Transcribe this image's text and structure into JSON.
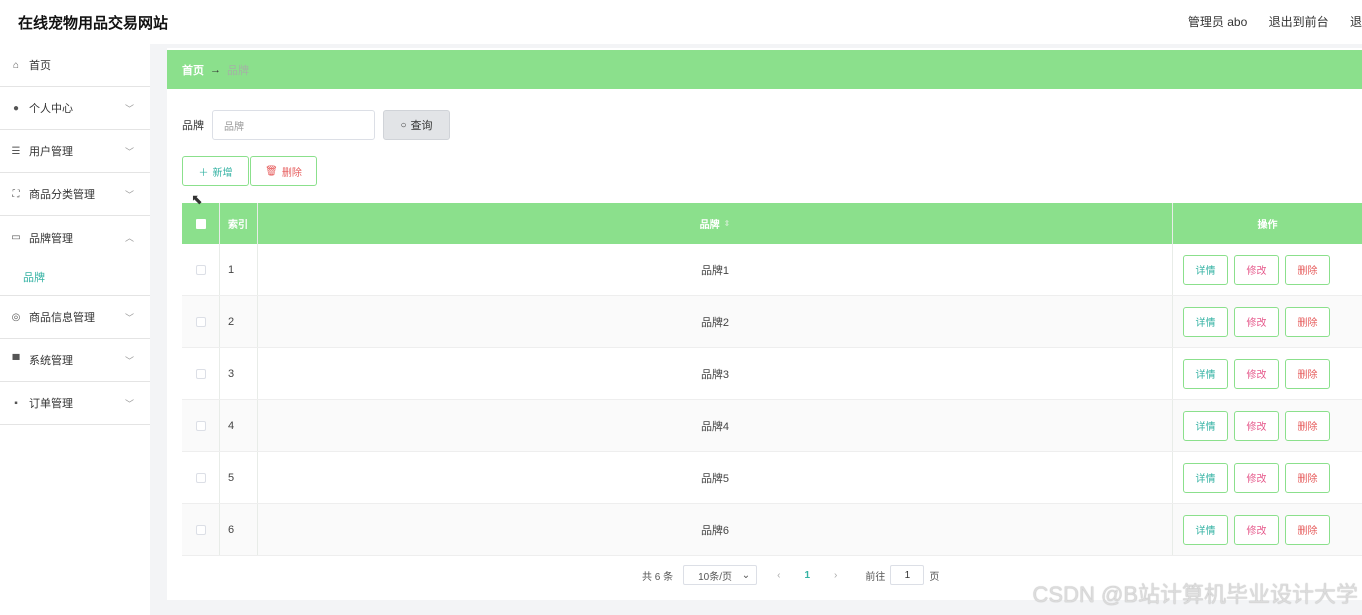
{
  "app": {
    "title": "在线宠物用品交易网站",
    "admin_label": "管理员 abo",
    "to_front": "退出到前台",
    "logout": "退"
  },
  "sidebar": {
    "items": [
      {
        "label": "首页",
        "icon": "home-icon"
      },
      {
        "label": "个人中心",
        "icon": "user-icon"
      },
      {
        "label": "用户管理",
        "icon": "list-icon"
      },
      {
        "label": "商品分类管理",
        "icon": "frame-icon"
      },
      {
        "label": "品牌管理",
        "icon": "chat-icon",
        "sub": "品牌"
      },
      {
        "label": "商品信息管理",
        "icon": "globe-icon"
      },
      {
        "label": "系统管理",
        "icon": "monitor-icon"
      },
      {
        "label": "订单管理",
        "icon": "message-icon"
      }
    ]
  },
  "breadcrumb": {
    "home": "首页",
    "arrow": "→",
    "current": "品牌"
  },
  "search": {
    "label": "品牌",
    "placeholder": "品牌",
    "button": "查询"
  },
  "actions": {
    "add": "新增",
    "delete": "删除"
  },
  "table": {
    "headers": {
      "index": "索引",
      "name": "品牌",
      "ops": "操作"
    },
    "rows": [
      {
        "index": "1",
        "name": "品牌1"
      },
      {
        "index": "2",
        "name": "品牌2"
      },
      {
        "index": "3",
        "name": "品牌3"
      },
      {
        "index": "4",
        "name": "品牌4"
      },
      {
        "index": "5",
        "name": "品牌5"
      },
      {
        "index": "6",
        "name": "品牌6"
      }
    ],
    "row_ops": {
      "detail": "详情",
      "edit": "修改",
      "delete": "删除"
    }
  },
  "pagination": {
    "total": "共 6 条",
    "page_size": "10条/页",
    "current_page": "1",
    "goto_label": "前往",
    "goto_value": "1",
    "page_suffix": "页"
  },
  "watermark": "CSDN @B站计算机毕业设计大学",
  "colors": {
    "accent": "#8be08c",
    "teal": "#33b2a3",
    "danger": "#e65a5a"
  }
}
